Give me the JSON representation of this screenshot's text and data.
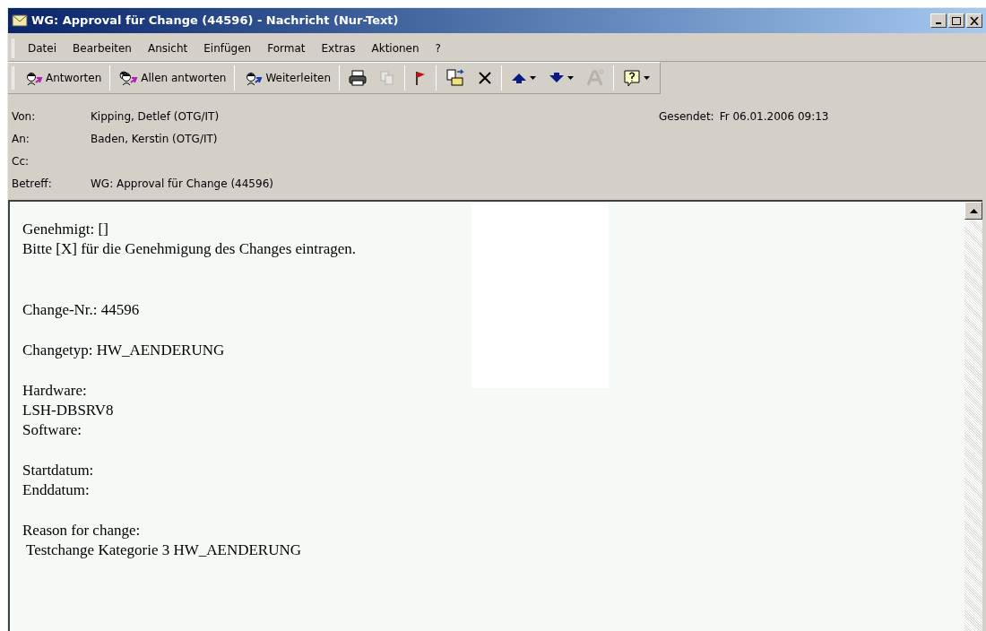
{
  "window": {
    "title": "WG: Approval für Change (44596) - Nachricht (Nur-Text)"
  },
  "menu": [
    "Datei",
    "Bearbeiten",
    "Ansicht",
    "Einfügen",
    "Format",
    "Extras",
    "Aktionen",
    "?"
  ],
  "toolbar": {
    "reply_buttons": [
      "Antworten",
      "Allen antworten",
      "Weiterleiten"
    ],
    "icon_buttons": [
      {
        "disabled": false,
        "dropdown": false
      },
      {
        "disabled": true,
        "dropdown": false
      },
      {
        "disabled": false,
        "dropdown": false
      },
      {
        "disabled": false,
        "dropdown": false
      },
      {
        "disabled": false,
        "dropdown": false
      },
      {
        "disabled": false,
        "dropdown": true
      },
      {
        "disabled": false,
        "dropdown": true
      },
      {
        "disabled": true,
        "dropdown": false
      },
      {
        "disabled": false,
        "dropdown": true
      }
    ]
  },
  "header": {
    "fields": [
      {
        "label": "Von:",
        "value": "Kipping, Detlef (OTG/IT)"
      },
      {
        "label": "An:",
        "value": "Baden, Kerstin (OTG/IT)"
      },
      {
        "label": "Cc:"
      },
      {
        "label": "Betreff:",
        "value": "WG: Approval für Change (44596)"
      }
    ],
    "sent_label": "Gesendet:",
    "sent_value": "Fr 06.01.2006 09:13"
  },
  "body": {
    "paragraphs": [
      {
        "lines": [
          "Genehmigt: []",
          "Bitte [X] für die Genehmigung des Changes eintragen."
        ]
      },
      {
        "lines": [
          "Change-Nr.: 44596"
        ]
      },
      {
        "lines": [
          "Changetyp: HW_AENDERUNG"
        ]
      },
      {
        "lines": [
          "Hardware:",
          "LSH-DBSRV8",
          "Software:"
        ]
      },
      {
        "lines": [
          "Startdatum:",
          "Enddatum:"
        ]
      },
      {
        "lines": [
          "Reason for change:",
          " Testchange Kategorie 3 HW_AENDERUNG"
        ]
      }
    ]
  }
}
